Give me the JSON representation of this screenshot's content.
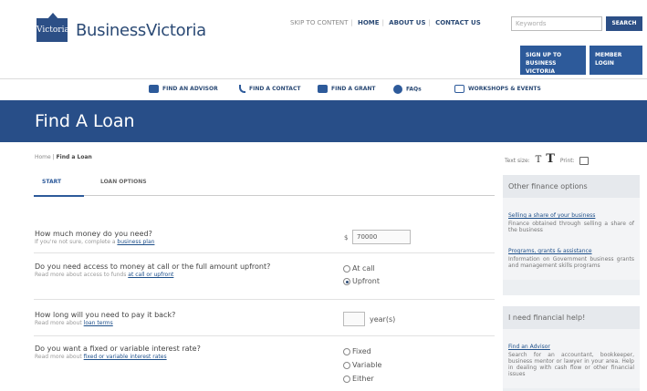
{
  "header": {
    "logo_text": "Victoria",
    "brand": "BusinessVictoria",
    "toplinks": {
      "skip": "SKIP TO CONTENT",
      "home": "HOME",
      "about": "ABOUT US",
      "contact": "CONTACT US"
    },
    "search_placeholder": "Keywords",
    "search_button": "SEARCH",
    "signup": "SIGN UP TO BUSINESS VICTORIA",
    "member": "MEMBER LOGIN"
  },
  "nav": {
    "items": [
      "FIND AN ADVISOR",
      "FIND A CONTACT",
      "FIND A GRANT",
      "FAQs",
      "WORKSHOPS & EVENTS"
    ]
  },
  "page_title": "Find A Loan",
  "breadcrumb": {
    "home": "Home",
    "current": "Find a Loan"
  },
  "tabs": {
    "start": "START",
    "options": "LOAN OPTIONS"
  },
  "questions": {
    "q1": {
      "label": "How much money do you need?",
      "sub_pre": "If you're not sure, complete a ",
      "sub_link": "business plan",
      "currency": "$",
      "value": "70000"
    },
    "q2": {
      "label": "Do you need access to money at call or the full amount upfront?",
      "sub_pre": "Read more about access to funds ",
      "sub_link": "at call or upfront",
      "opt1": "At call",
      "opt2": "Upfront"
    },
    "q3": {
      "label": "How long will you need to pay it back?",
      "sub_pre": "Read more about ",
      "sub_link": "loan terms",
      "unit": "year(s)"
    },
    "q4": {
      "label": "Do you want a fixed or variable interest rate?",
      "sub_pre": "Read more about ",
      "sub_link": "fixed or variable interest rates",
      "opt1": "Fixed",
      "opt2": "Variable",
      "opt3": "Either"
    }
  },
  "sidebar": {
    "text_size_label": "Text size:",
    "print_label": "Print:",
    "panel1": {
      "heading": "Other finance options",
      "items": [
        {
          "link": "Selling a share of your business",
          "desc": "Finance obtained through selling a share of the business"
        },
        {
          "link": "Programs, grants & assistance",
          "desc": "Information on Government business grants and management skills programs"
        }
      ]
    },
    "panel2": {
      "heading": "I need financial help!",
      "items": [
        {
          "link": "Find an Advisor",
          "desc": "Search for an accountant, bookkeeper, business mentor or lawyer in your area. Help in dealing with cash flow or other financial issues"
        }
      ]
    }
  }
}
